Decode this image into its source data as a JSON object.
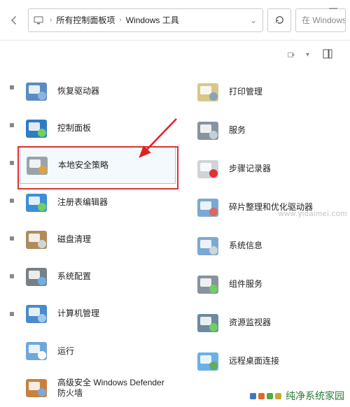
{
  "window": {
    "minimize_glyph": "—",
    "breadcrumb": {
      "seg1": "所有控制面板项",
      "seg2": "Windows 工具"
    },
    "search_placeholder": "在 Windows 工",
    "view_label": "□▫"
  },
  "items_left": [
    {
      "name": "recovery-drive",
      "label": "恢复驱动器",
      "icon_bg": "#5b8bc3",
      "icon_accent": "#8fb4dc"
    },
    {
      "name": "control-panel",
      "label": "控制面板",
      "icon_bg": "#2f7cc0",
      "icon_accent": "#6fcf60"
    },
    {
      "name": "local-security-policy",
      "label": "本地安全策略",
      "icon_bg": "#9aa3a8",
      "icon_accent": "#d9a443",
      "highlight": true
    },
    {
      "name": "registry-editor",
      "label": "注册表编辑器",
      "icon_bg": "#3b8fd6",
      "icon_accent": "#6fcf60"
    },
    {
      "name": "disk-cleanup",
      "label": "磁盘清理",
      "icon_bg": "#b08b5c",
      "icon_accent": "#cfd6da"
    },
    {
      "name": "system-configuration",
      "label": "系统配置",
      "icon_bg": "#7a7f84",
      "icon_accent": "#6bb0e6"
    },
    {
      "name": "computer-management",
      "label": "计算机管理",
      "icon_bg": "#4a8cca",
      "icon_accent": "#a0c9ea"
    },
    {
      "name": "run",
      "label": "运行",
      "icon_bg": "#6fa8d8",
      "icon_accent": "#ffffff"
    },
    {
      "name": "windows-defender-firewall",
      "label": "高级安全 Windows Defender 防火墙",
      "icon_bg": "#c9803d",
      "icon_accent": "#7aa9d4"
    }
  ],
  "items_right": [
    {
      "name": "print-management",
      "label": "打印管理",
      "icon_bg": "#d6c889",
      "icon_accent": "#8aa4b6"
    },
    {
      "name": "services",
      "label": "服务",
      "icon_bg": "#8893a0",
      "icon_accent": "#c7cfd6"
    },
    {
      "name": "steps-recorder",
      "label": "步骤记录器",
      "icon_bg": "#d0d4d8",
      "icon_accent": "#d33"
    },
    {
      "name": "defragment-optimize",
      "label": "碎片整理和优化驱动器",
      "icon_bg": "#7aa9d4",
      "icon_accent": "#d66"
    },
    {
      "name": "system-information",
      "label": "系统信息",
      "icon_bg": "#7aa9d4",
      "icon_accent": "#cfd6da"
    },
    {
      "name": "component-services",
      "label": "组件服务",
      "icon_bg": "#8893a0",
      "icon_accent": "#6fcf60"
    },
    {
      "name": "resource-monitor",
      "label": "资源监视器",
      "icon_bg": "#6c8aa0",
      "icon_accent": "#6fcf60"
    },
    {
      "name": "remote-desktop",
      "label": "远程桌面连接",
      "icon_bg": "#6bb0e6",
      "icon_accent": "#5fae5f"
    }
  ],
  "watermark": "www.yidaimei.com",
  "brand": "纯净系统家园",
  "brand_colors": [
    "#3a78c2",
    "#e06a2b",
    "#5aa746",
    "#c7a93a"
  ]
}
